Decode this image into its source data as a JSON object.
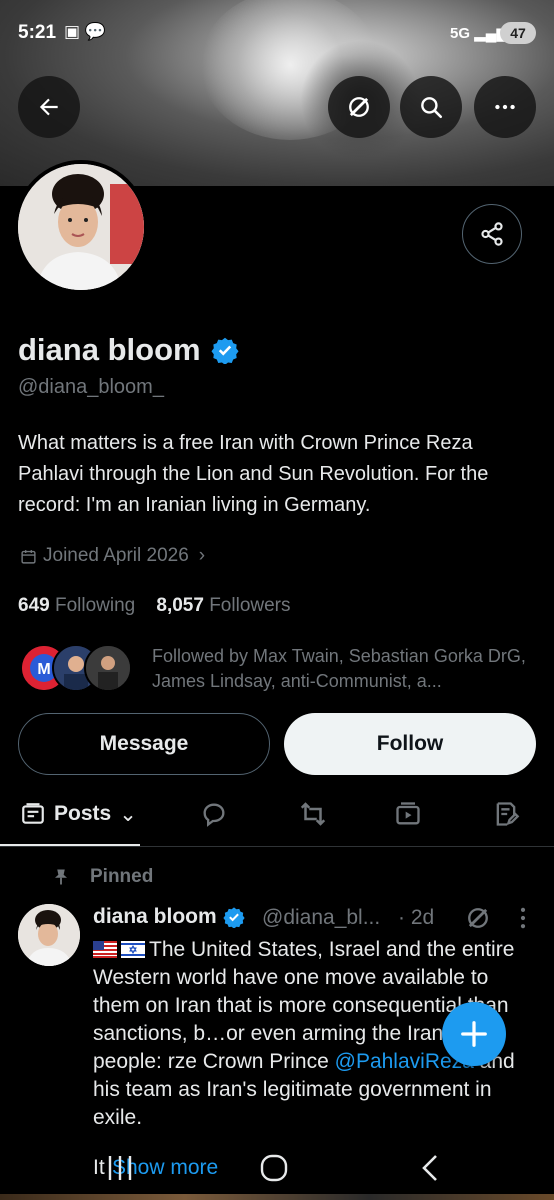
{
  "status_bar": {
    "time": "5:21",
    "network": "5G",
    "battery": "47"
  },
  "header": {
    "back": "back-arrow",
    "grok": "grok-icon",
    "search": "search-icon",
    "more": "more-icon"
  },
  "profile": {
    "name": "diana bloom",
    "handle": "@diana_bloom_",
    "bio": "What matters is a free Iran with Crown Prince Reza Pahlavi through the Lion and Sun Revolution. For the record: I'm an Iranian living in Germany.",
    "joined": "Joined April 2026",
    "following_count": "649",
    "following_label": "Following",
    "followers_count": "8,057",
    "followers_label": "Followers",
    "followed_by": "Followed by Max Twain, Sebastian Gorka DrG, James Lindsay, anti-Communist, a..."
  },
  "actions": {
    "message": "Message",
    "follow": "Follow"
  },
  "tabs": {
    "posts": "Posts"
  },
  "pinned_post": {
    "pinned_label": "Pinned",
    "author": "diana bloom",
    "handle": "@diana_bl...",
    "time": "· 2d",
    "text_before": "The United States, Israel and the entire Western world have one move available to them on Iran that is more consequential than sanctions, b",
    "text_hidden": "…or even arming the Iranian people: r",
    "text_after_fab": "ze Crown Prince ",
    "mention": "@PahlaviReza",
    "text_end": " and his team as Iran's legitimate government in exile.",
    "tail": "It",
    "show_more": "Show more"
  },
  "colors": {
    "accent": "#1d9bf0",
    "background": "#000000",
    "muted": "#71767b"
  }
}
